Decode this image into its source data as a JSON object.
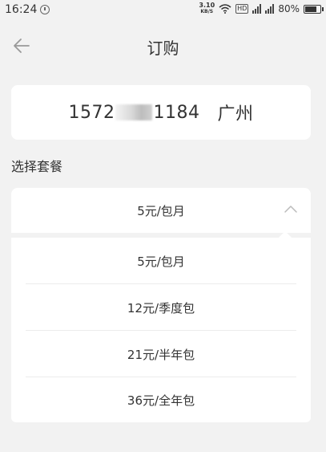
{
  "status_bar": {
    "time": "16:24",
    "net_speed_value": "3.10",
    "net_speed_unit": "KB/S",
    "hd_label": "HD",
    "battery": "80%"
  },
  "header": {
    "title": "订购"
  },
  "phone_card": {
    "number_prefix": "1572",
    "number_suffix": "1184",
    "city": "广州"
  },
  "section_label": "选择套餐",
  "select": {
    "selected_value": "5元/包月"
  },
  "dropdown": {
    "options": [
      "5元/包月",
      "12元/季度包",
      "21元/半年包",
      "36元/全年包"
    ]
  }
}
